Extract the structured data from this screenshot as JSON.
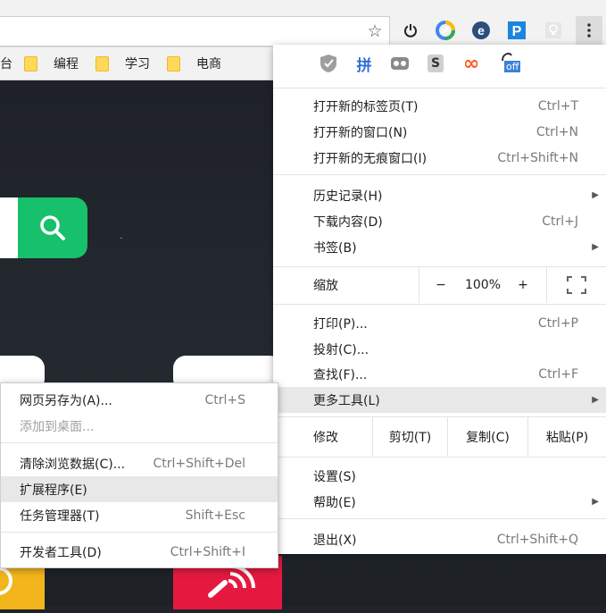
{
  "bookmarks": [
    {
      "label": "台"
    },
    {
      "label": "编程"
    },
    {
      "label": "学习"
    },
    {
      "label": "电商"
    }
  ],
  "toolbar_icons": [
    "star-icon",
    "power-icon",
    "color-ring-icon",
    "e-extension-icon",
    "p-extension-icon",
    "bulb-icon",
    "menu-dots-icon"
  ],
  "extensions": [
    {
      "name": "shield-icon",
      "text": ""
    },
    {
      "name": "pin-icon",
      "text": "拼"
    },
    {
      "name": "gamepad-icon",
      "text": ""
    },
    {
      "name": "s-icon",
      "text": "S"
    },
    {
      "name": "infinity-icon",
      "text": "∞"
    },
    {
      "name": "off-icon",
      "text": "off"
    }
  ],
  "menu": {
    "group1": [
      {
        "label": "打开新的标签页(T)",
        "shortcut": "Ctrl+T"
      },
      {
        "label": "打开新的窗口(N)",
        "shortcut": "Ctrl+N"
      },
      {
        "label": "打开新的无痕窗口(I)",
        "shortcut": "Ctrl+Shift+N"
      }
    ],
    "group2": [
      {
        "label": "历史记录(H)",
        "shortcut": ""
      },
      {
        "label": "下载内容(D)",
        "shortcut": "Ctrl+J"
      },
      {
        "label": "书签(B)",
        "shortcut": ""
      }
    ],
    "zoom": {
      "label": "缩放",
      "minus": "−",
      "value": "100%",
      "plus": "+"
    },
    "group3": [
      {
        "label": "打印(P)...",
        "shortcut": "Ctrl+P"
      },
      {
        "label": "投射(C)...",
        "shortcut": ""
      },
      {
        "label": "查找(F)...",
        "shortcut": "Ctrl+F"
      },
      {
        "label": "更多工具(L)",
        "shortcut": ""
      }
    ],
    "edit": {
      "label": "修改",
      "cut": "剪切(T)",
      "copy": "复制(C)",
      "paste": "粘贴(P)"
    },
    "group4": [
      {
        "label": "设置(S)",
        "shortcut": ""
      },
      {
        "label": "帮助(E)",
        "shortcut": ""
      }
    ],
    "exit": {
      "label": "退出(X)",
      "shortcut": "Ctrl+Shift+Q"
    }
  },
  "submenu": {
    "group1": [
      {
        "label": "网页另存为(A)...",
        "shortcut": "Ctrl+S"
      },
      {
        "label": "添加到桌面...",
        "shortcut": ""
      }
    ],
    "group2": [
      {
        "label": "清除浏览数据(C)...",
        "shortcut": "Ctrl+Shift+Del"
      },
      {
        "label": "扩展程序(E)",
        "shortcut": ""
      },
      {
        "label": "任务管理器(T)",
        "shortcut": "Shift+Esc"
      }
    ],
    "group3": [
      {
        "label": "开发者工具(D)",
        "shortcut": "Ctrl+Shift+I"
      }
    ]
  },
  "colors": {
    "accent_green": "#17c06a",
    "highlight": "#e8e8e8",
    "folder": "#ffd85a"
  }
}
